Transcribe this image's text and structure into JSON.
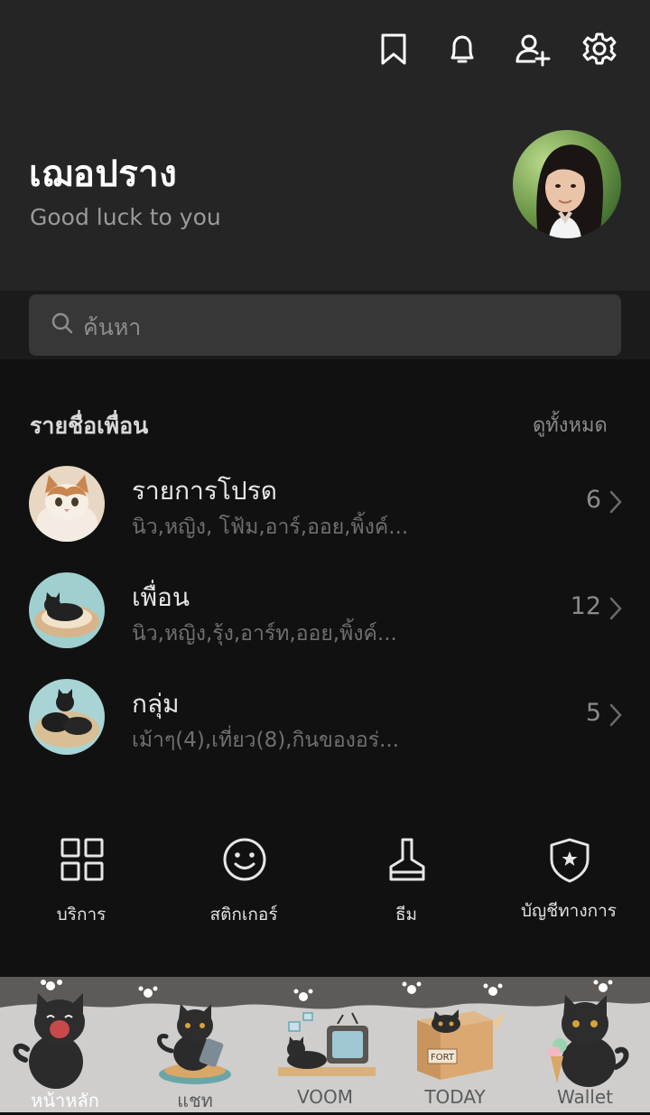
{
  "header": {
    "icons": [
      "bookmark-icon",
      "bell-icon",
      "add-friend-icon",
      "gear-icon"
    ],
    "profile_name": "เฌอปราง",
    "status_message": "Good luck to you"
  },
  "search": {
    "placeholder": "ค้นหา"
  },
  "friends_section": {
    "title": "รายชื่อเพื่อน",
    "see_all": "ดูทั้งหมด",
    "rows": [
      {
        "title": "รายการโปรด",
        "subtitle": "นิว,หญิง, โฟ้ม,อาร์,ออย,พิ้งค์...",
        "count": "6"
      },
      {
        "title": "เพื่อน",
        "subtitle": "นิว,หญิง,รุ้ง,อาร์ท,ออย,พิ้งค์...",
        "count": "12"
      },
      {
        "title": "กลุ่ม",
        "subtitle": "เม้าๆ(4),เที่ยว(8),กินของอร่...",
        "count": "5"
      }
    ]
  },
  "quick_actions": [
    {
      "label": "บริการ",
      "icon": "grid-icon"
    },
    {
      "label": "สติกเกอร์",
      "icon": "smiley-icon"
    },
    {
      "label": "ธีม",
      "icon": "brush-icon"
    },
    {
      "label": "บัญชีทางการ",
      "icon": "shield-star-icon"
    }
  ],
  "tabs": [
    {
      "label": "หน้าหลัก",
      "icon": "home-cat-icon",
      "active": true
    },
    {
      "label": "แชท",
      "icon": "chat-cat-icon"
    },
    {
      "label": "VOOM",
      "icon": "voom-cat-icon"
    },
    {
      "label": "TODAY",
      "icon": "today-cat-icon",
      "box_text": "FORT"
    },
    {
      "label": "Wallet",
      "icon": "wallet-cat-icon"
    }
  ],
  "colors": {
    "header_bg": "#252525",
    "body_bg": "#111111",
    "search_bg": "#373737",
    "tabbar_bg": "#cfcecd"
  }
}
